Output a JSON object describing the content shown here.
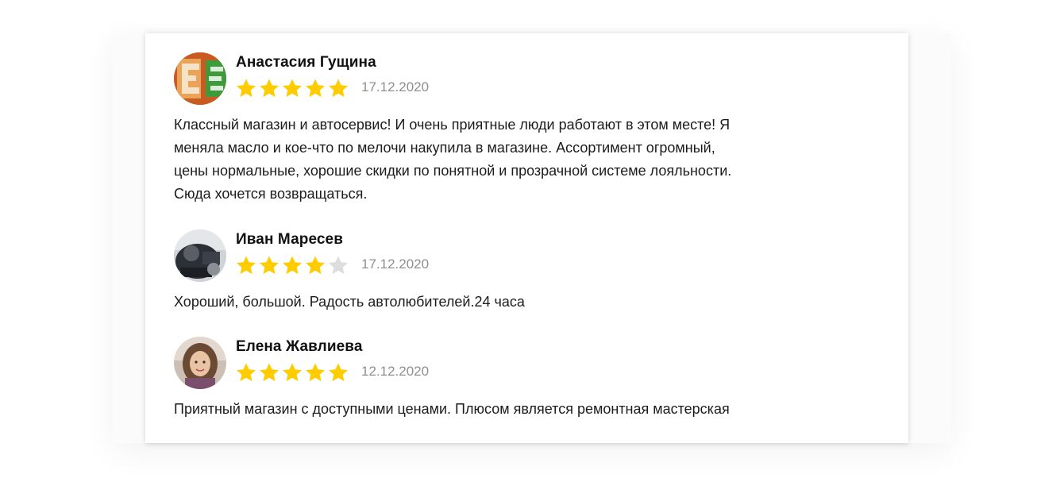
{
  "reviews": [
    {
      "author": "Анастасия Гущина",
      "rating": 5,
      "date": "17.12.2020",
      "text_lines": [
        "Классный магазин и автосервис! И очень приятные люди работают в этом месте! Я",
        "меняла масло и кое-что по мелочи накупила в магазине. Ассортимент огромный,",
        "цены нормальные, хорошие скидки по понятной и прозрачной системе лояльности.",
        "Сюда хочется возвращаться."
      ]
    },
    {
      "author": "Иван Маресев",
      "rating": 4,
      "date": "17.12.2020",
      "text_lines": [
        "Хороший, большой. Радость автолюбителей.24 часа"
      ]
    },
    {
      "author": "Елена Жавлиева",
      "rating": 5,
      "date": "12.12.2020",
      "text_lines": [
        "Приятный магазин с доступными ценами. Плюсом является ремонтная мастерская"
      ]
    }
  ],
  "colors": {
    "star_filled": "#ffcc00",
    "star_empty": "#dddddd",
    "date": "#8f8f8f",
    "text": "#1c1c1c"
  }
}
